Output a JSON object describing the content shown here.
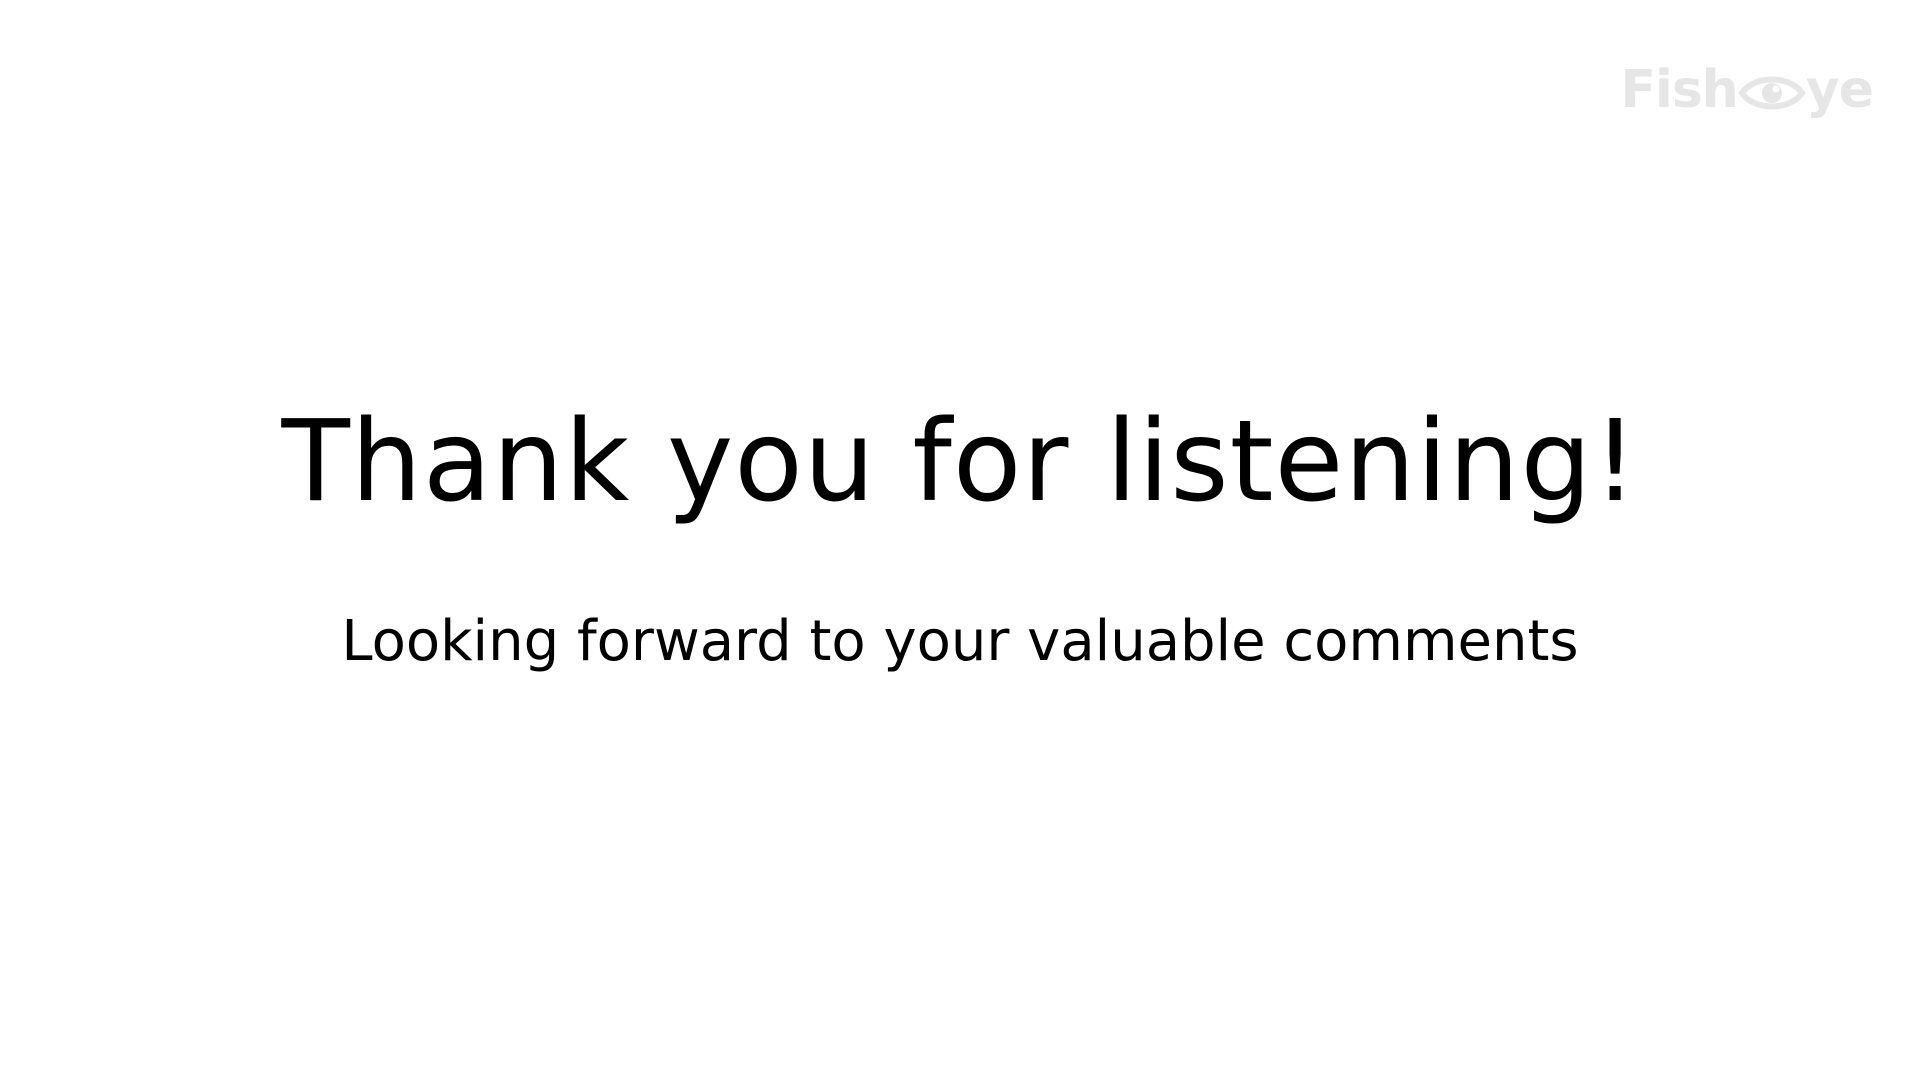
{
  "logo": {
    "text_before": "Fish",
    "icon": "eye-icon",
    "text_after": "ye",
    "color": "#e6e6e6"
  },
  "slide": {
    "title": "Thank you for listening!",
    "subtitle": "Looking forward to your valuable comments"
  },
  "colors": {
    "background": "#ffffff",
    "text": "#000000"
  }
}
